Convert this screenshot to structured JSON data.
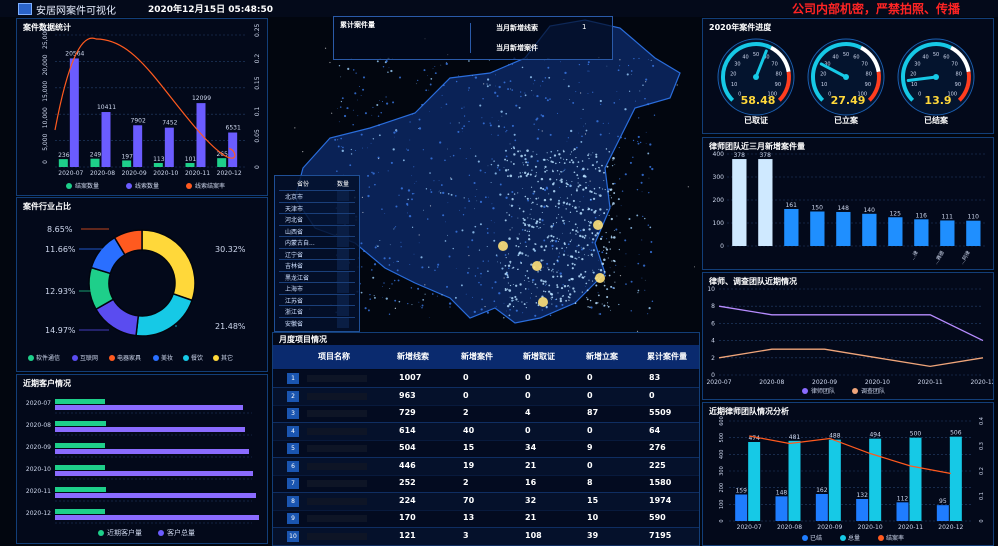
{
  "header": {
    "title": "安居网案件可视化",
    "datetime": "2020年12月15日 05:48:50",
    "warning": "公司内部机密，严禁拍照、传播"
  },
  "colors": {
    "green": "#1ecf8a",
    "purple": "#6b5cff",
    "orange": "#ff5a1f",
    "cyan": "#16c9e6",
    "yellow": "#ffd83a",
    "pink": "#d06bff"
  },
  "case_stats": {
    "title": "案件数据统计",
    "chart_data": {
      "type": "bar",
      "categories": [
        "2020-07",
        "2020-08",
        "2020-09",
        "2020-10",
        "2020-11",
        "2020-12"
      ],
      "series": [
        {
          "name": "结案数量",
          "values": [
            236,
            249,
            197,
            113,
            101,
            265
          ]
        },
        {
          "name": "线索数量",
          "values": [
            20564,
            10411,
            7902,
            7452,
            12099,
            6531
          ]
        },
        {
          "name": "线索结案率",
          "values": [
            0.2,
            0.245,
            0.25,
            0.2,
            0.1,
            0.035
          ]
        }
      ],
      "y_ticks": [
        "0",
        "5,000",
        "10,000",
        "15,000",
        "20,000",
        "25,000"
      ],
      "y2_ticks": [
        "0",
        "0.05",
        "0.1",
        "0.15",
        "0.2",
        "0.25"
      ],
      "ylim": [
        0,
        25000
      ],
      "y2lim": [
        0,
        0.25
      ]
    }
  },
  "industry": {
    "title": "案件行业占比",
    "chart_data": {
      "type": "pie",
      "labels": [
        "软件通信",
        "互联网",
        "电器家具",
        "美妆",
        "餐饮",
        "其它"
      ],
      "values": [
        14.97,
        12.93,
        11.66,
        8.65,
        30.32,
        21.48
      ]
    },
    "pct_labels": [
      "8.65%",
      "11.66%",
      "12.93%",
      "14.97%",
      "30.32%",
      "21.48%"
    ]
  },
  "clients": {
    "title": "近期客户情况",
    "chart_data": {
      "type": "bar",
      "categories": [
        "2020-07",
        "2020-08",
        "2020-09",
        "2020-10",
        "2020-11",
        "2020-12"
      ],
      "series": [
        {
          "name": "近期客户量",
          "values": [
            50,
            51,
            50,
            50,
            51,
            50
          ]
        },
        {
          "name": "客户总量",
          "values": [
            188,
            190,
            194,
            198,
            201,
            204
          ]
        }
      ]
    }
  },
  "map_box": {
    "total_label": "累计案件量",
    "month_new_clue": "当月新增线索",
    "month_new_case": "当月新增案件",
    "month_new_clue_val": "1"
  },
  "province_table": {
    "headers": [
      "省份",
      "数量"
    ],
    "rows": [
      "北京市",
      "天津市",
      "河北省",
      "山西省",
      "内蒙古自...",
      "辽宁省",
      "吉林省",
      "黑龙江省",
      "上海市",
      "江苏省",
      "浙江省",
      "安徽省"
    ]
  },
  "monthly": {
    "title": "月度项目情况",
    "headers": [
      "项目名称",
      "新增线索",
      "新增案件",
      "新增取证",
      "新增立案",
      "累计案件量"
    ],
    "rows": [
      [
        "1",
        "1007",
        "0",
        "0",
        "0",
        "83"
      ],
      [
        "2",
        "963",
        "0",
        "0",
        "0",
        "0"
      ],
      [
        "3",
        "729",
        "2",
        "4",
        "87",
        "5509"
      ],
      [
        "4",
        "614",
        "40",
        "0",
        "0",
        "64"
      ],
      [
        "5",
        "504",
        "15",
        "34",
        "9",
        "276"
      ],
      [
        "6",
        "446",
        "19",
        "21",
        "0",
        "225"
      ],
      [
        "7",
        "252",
        "2",
        "16",
        "8",
        "1580"
      ],
      [
        "8",
        "224",
        "70",
        "32",
        "15",
        "1974"
      ],
      [
        "9",
        "170",
        "13",
        "21",
        "10",
        "590"
      ],
      [
        "10",
        "121",
        "3",
        "108",
        "39",
        "7195"
      ]
    ]
  },
  "progress": {
    "title": "2020年案件进度",
    "gauges": [
      {
        "value": "58.48",
        "label": "已取证",
        "color": "#ffd83a",
        "level": 0.58
      },
      {
        "value": "27.49",
        "label": "已立案",
        "color": "#ffd83a",
        "level": 0.27
      },
      {
        "value": "13.9",
        "label": "已结案",
        "color": "#ffd83a",
        "level": 0.14
      }
    ],
    "tick_labels": [
      "0",
      "10",
      "20",
      "30",
      "40",
      "50",
      "60",
      "70",
      "80",
      "90",
      "100"
    ]
  },
  "lawyers": {
    "title": "律师团队近三月新增案件量",
    "chart_data": {
      "type": "bar",
      "values": [
        378,
        378,
        161,
        150,
        148,
        140,
        125,
        116,
        111,
        110
      ],
      "categories": [
        "",
        "",
        "",
        "",
        "",
        "",
        "",
        "...律",
        "...赛德",
        "...阿律"
      ],
      "ylim": [
        0,
        400
      ],
      "y_ticks": [
        "0",
        "100",
        "200",
        "300",
        "400"
      ]
    }
  },
  "teams": {
    "title": "律师、调查团队近期情况",
    "chart_data": {
      "type": "line",
      "categories": [
        "2020-07",
        "2020-08",
        "2020-09",
        "2020-10",
        "2020-11",
        "2020-12"
      ],
      "series": [
        {
          "name": "律师团队",
          "values": [
            8,
            7,
            7,
            7,
            7,
            4
          ]
        },
        {
          "name": "调查团队",
          "values": [
            2,
            3,
            3,
            2,
            1,
            2
          ]
        }
      ],
      "ylim": [
        0,
        10
      ],
      "y_ticks": [
        "0",
        "2",
        "4",
        "6",
        "8",
        "10"
      ]
    }
  },
  "recent_lawyer": {
    "title": "近期律师团队情况分析",
    "chart_data": {
      "type": "bar",
      "categories": [
        "2020-07",
        "2020-08",
        "2020-09",
        "2020-10",
        "2020-11",
        "2020-12"
      ],
      "series": [
        {
          "name": "已结",
          "values": [
            159,
            148,
            162,
            132,
            112,
            95
          ]
        },
        {
          "name": "总量",
          "values": [
            474,
            481,
            488,
            494,
            500,
            506
          ]
        },
        {
          "name": "结案率",
          "values": [
            0.34,
            0.31,
            0.33,
            0.27,
            0.22,
            0.19
          ]
        }
      ],
      "y_ticks": [
        "0",
        "100",
        "200",
        "300",
        "400",
        "500",
        "600"
      ],
      "y2_ticks": [
        "0",
        "0.1",
        "0.2",
        "0.3",
        "0.4"
      ]
    }
  }
}
